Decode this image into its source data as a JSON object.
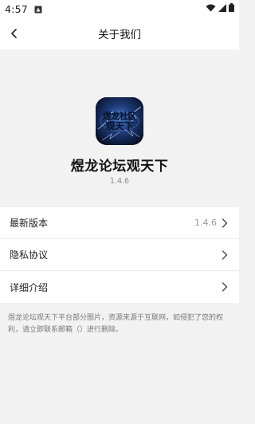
{
  "status_bar": {
    "time": "4:57"
  },
  "header": {
    "title": "关于我们"
  },
  "app": {
    "name": "煜龙论坛观天下",
    "version": "1.4.6",
    "icon_text_line1": "煜龙社区",
    "icon_text_line2": "观天下"
  },
  "list": {
    "items": [
      {
        "label": "最新版本",
        "value": "1.4.6"
      },
      {
        "label": "隐私协议",
        "value": ""
      },
      {
        "label": "详细介绍",
        "value": ""
      }
    ]
  },
  "disclaimer": "煜龙论坛观天下平台部分图片，资源来源于互联网，如侵犯了您的权利，请立即联系邮箱（）进行删除。",
  "colors": {
    "background": "#f2f2f2",
    "surface": "#ffffff",
    "muted_text": "#999999"
  },
  "icons": [
    "back-arrow-icon",
    "chevron-right-icon",
    "wifi-icon",
    "signal-icon",
    "battery-icon",
    "notification-icon"
  ]
}
